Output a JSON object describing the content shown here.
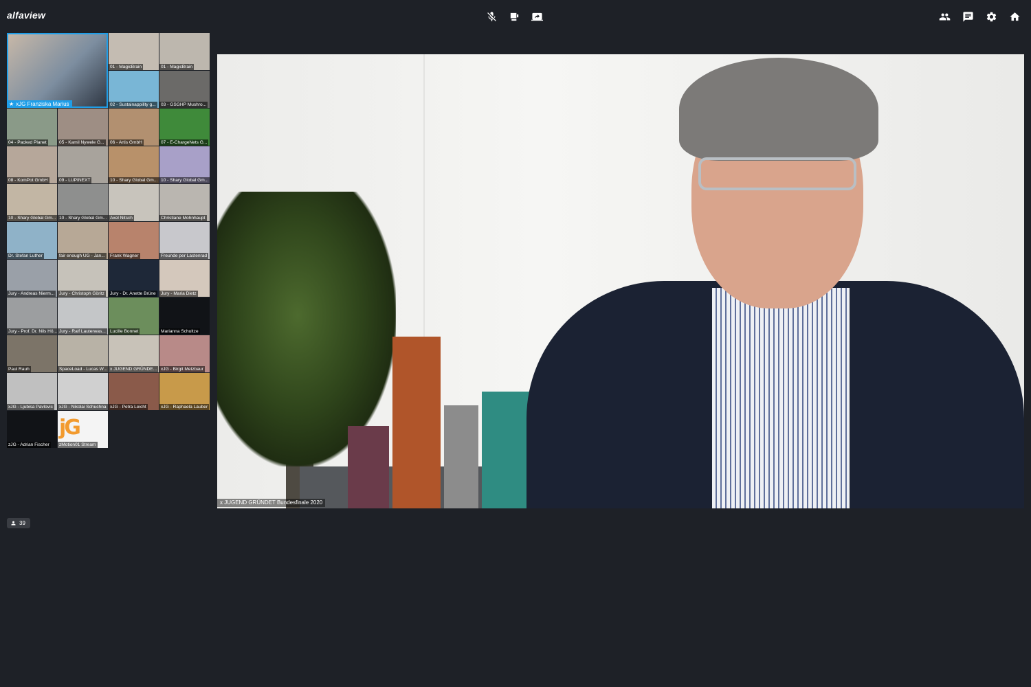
{
  "app": {
    "name": "alfaview"
  },
  "colors": {
    "background": "#1e2127",
    "accent": "#1f9ee8"
  },
  "toolbar_center": [
    {
      "name": "mic-off-icon"
    },
    {
      "name": "camera-icon"
    },
    {
      "name": "screen-share-icon"
    }
  ],
  "toolbar_right": [
    {
      "name": "participants-icon"
    },
    {
      "name": "chat-icon"
    },
    {
      "name": "settings-icon"
    },
    {
      "name": "home-icon"
    }
  ],
  "featured_tile": {
    "label": "xJG Franziska Marius",
    "star_icon": "star-icon"
  },
  "tiles": [
    {
      "label": "01 - MagicBrain",
      "color": "#c4bcb2"
    },
    {
      "label": "01 - MagicBrain",
      "color": "#bdb7ae"
    },
    {
      "label": "02 - Sustainappility g...",
      "color": "#79b6d6"
    },
    {
      "label": "03 - GSGHP Mushro...",
      "color": "#6b6a68"
    },
    {
      "label": "04 - Packed Planet",
      "color": "#8a9a88"
    },
    {
      "label": "05 - Kamil Nywele G...",
      "color": "#9e8e84"
    },
    {
      "label": "06 - Artis GmbH",
      "color": "#b29070"
    },
    {
      "label": "07 - E-ChargeNets G...",
      "color": "#3f8a3a"
    },
    {
      "label": "08 - KomPot GmbH",
      "color": "#b6a79a"
    },
    {
      "label": "09 - LUPINEXT",
      "color": "#a8a39c"
    },
    {
      "label": "10 - Shary Global Gm...",
      "color": "#b8916a"
    },
    {
      "label": "10 - Shary Global Gm...",
      "color": "#a8a0c8"
    },
    {
      "label": "10 - Shary Global Gm...",
      "color": "#c2b6a4"
    },
    {
      "label": "10 - Shary Global Gm...",
      "color": "#8e8f8e"
    },
    {
      "label": "Axel Nitsch",
      "color": "#c8c4bc"
    },
    {
      "label": "Christiane Mohnhaupt",
      "color": "#bab6b0"
    },
    {
      "label": "Dr. Stefan Luther",
      "color": "#8fb2c8"
    },
    {
      "label": "fair enough UG - Jan...",
      "color": "#b7a896"
    },
    {
      "label": "Frank Wagner",
      "color": "#b8836c"
    },
    {
      "label": "Freunde per Lastenrad",
      "color": "#c8c8cc"
    },
    {
      "label": "Jury - Andreas Nierm...",
      "color": "#9aa0a8"
    },
    {
      "label": "Jury - Christoph Göritz",
      "color": "#c6c2ba"
    },
    {
      "label": "Jury - Dr. Anette Brüne",
      "color": "#1e2838"
    },
    {
      "label": "Jury - Maria Dietz",
      "color": "#d4c8bc"
    },
    {
      "label": "Jury - Prof. Dr. Nils Hö...",
      "color": "#9c9ea0"
    },
    {
      "label": "Jury - Ralf Lauterwas...",
      "color": "#c4c6c8"
    },
    {
      "label": "Lucille Bonnet",
      "color": "#6c8e5c"
    },
    {
      "label": "Marianna Schultze",
      "color": "#111317",
      "black": true
    },
    {
      "label": "Paul Rauh",
      "color": "#7c7468"
    },
    {
      "label": "SpaceLoad - Lucas W...",
      "color": "#b8b2a6"
    },
    {
      "label": "x JUGEND GRÜNDE...",
      "color": "#c8c2b8"
    },
    {
      "label": "xJG - Birgit Metzbaur",
      "color": "#b88a88"
    },
    {
      "label": "xJG - Ljubisa Pavlovic",
      "color": "#c0c0c0"
    },
    {
      "label": "xJG - Nikolai Schuchna",
      "color": "#d0d0d0"
    },
    {
      "label": "xJG - Petra Leicht",
      "color": "#8a5a4a"
    },
    {
      "label": "xJG - Raphaela Lauber",
      "color": "#c89a4a"
    },
    {
      "label": "zJG - Adrian Fischer",
      "color": "#111317",
      "black": true
    },
    {
      "label": "zMotion01 Stream",
      "color": "#f4f4f4",
      "logo": "jG"
    }
  ],
  "participants": {
    "count": "39",
    "icon": "person-icon"
  },
  "main_video": {
    "label": "x JUGEND GRÜNDET Bundesfinale 2020"
  }
}
